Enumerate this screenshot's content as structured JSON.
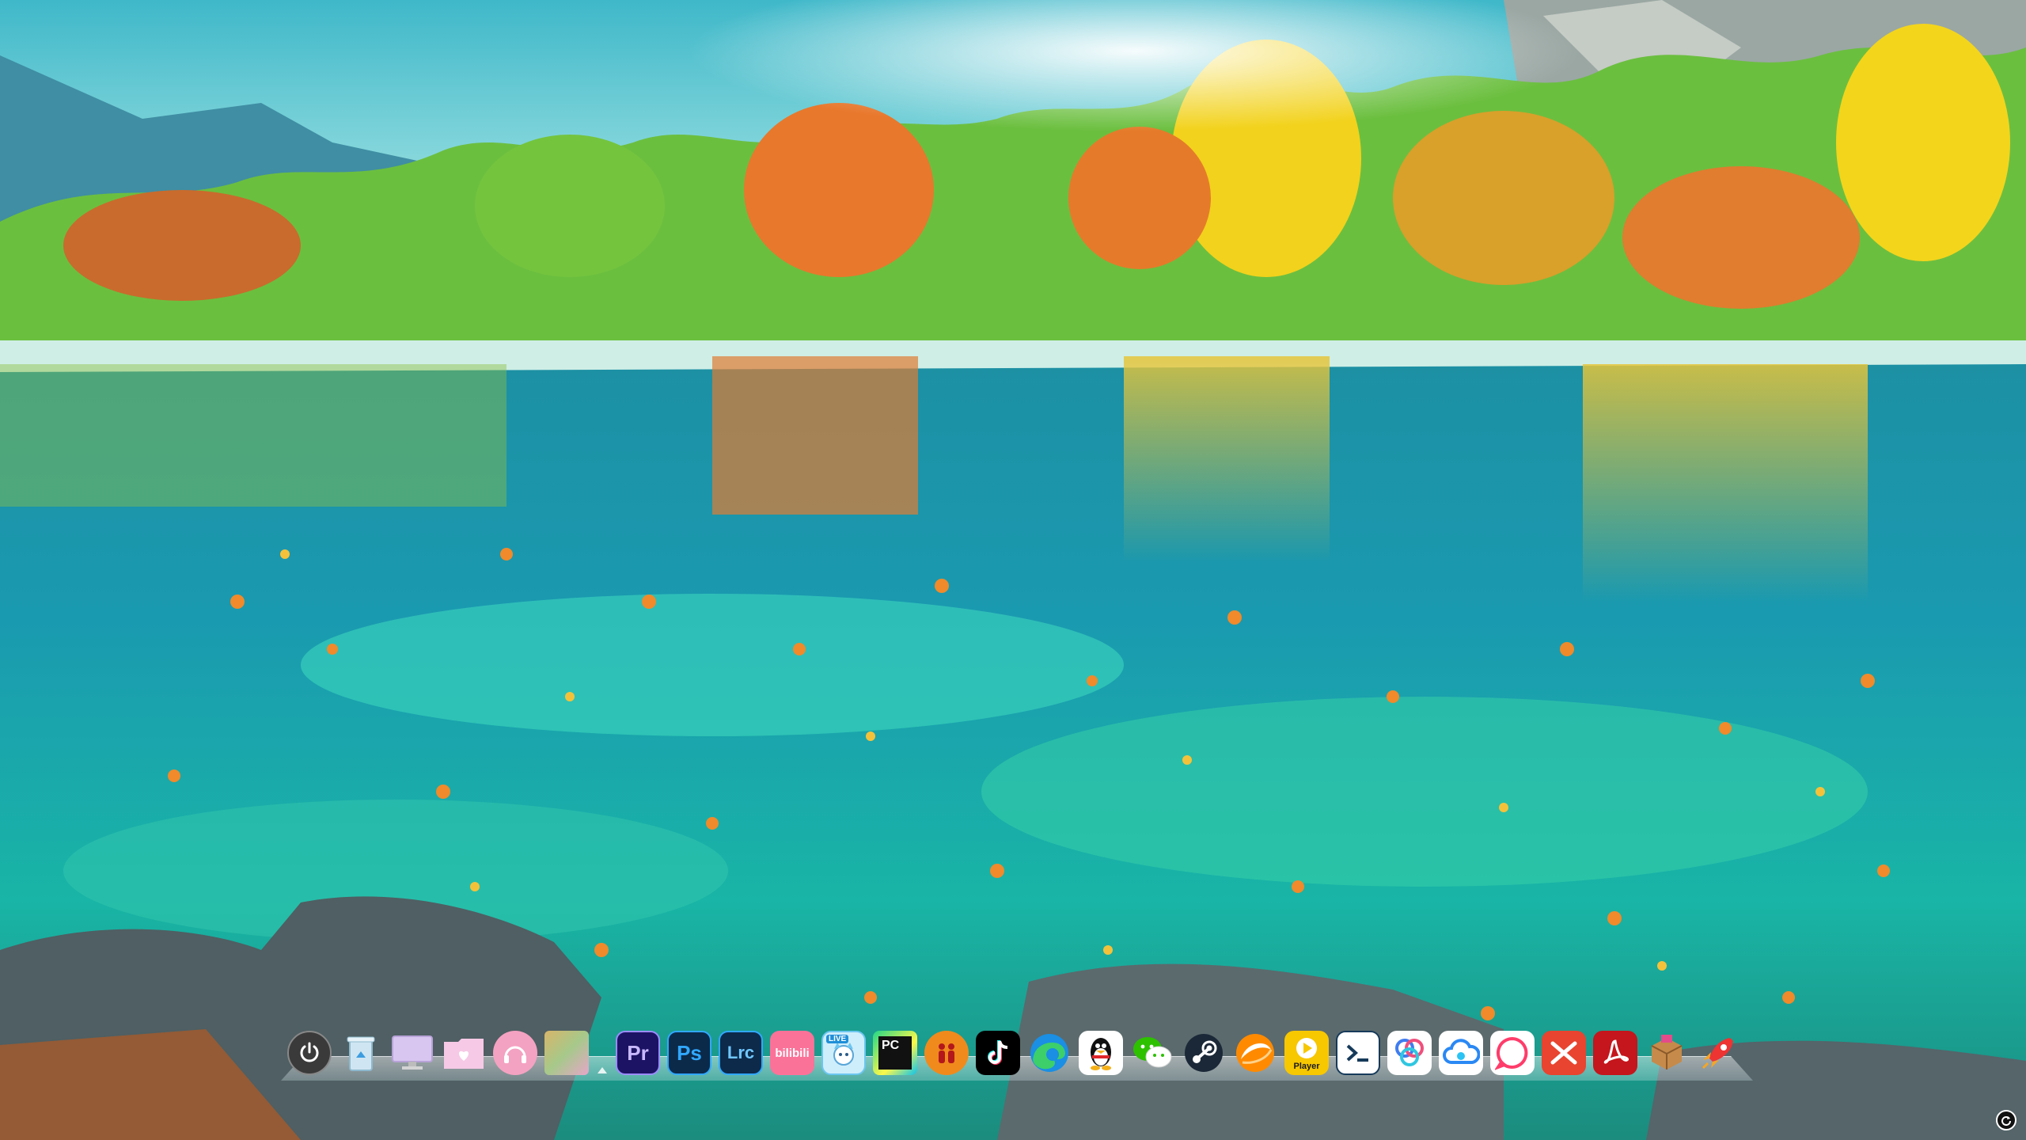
{
  "wallpaper": {
    "description_icon": "landscape-wallpaper",
    "colors": {
      "sky": "#7fd2dc",
      "water": "#19a6a8",
      "autumn": "#f0b419"
    }
  },
  "dock": {
    "items": [
      {
        "id": "power",
        "icon": "power-icon",
        "label": ""
      },
      {
        "id": "recycle-bin",
        "icon": "recycle-bin-icon",
        "label": ""
      },
      {
        "id": "this-pc",
        "icon": "monitor-icon",
        "label": ""
      },
      {
        "id": "folder",
        "icon": "folder-heart-icon",
        "label": ""
      },
      {
        "id": "music",
        "icon": "headphones-icon",
        "label": ""
      },
      {
        "id": "photos",
        "icon": "photos-icon",
        "label": ""
      },
      {
        "id": "premiere",
        "icon": "premiere-icon",
        "label": "Pr",
        "color": "#1d1364"
      },
      {
        "id": "photoshop",
        "icon": "photoshop-icon",
        "label": "Ps",
        "color": "#0b2a4a"
      },
      {
        "id": "lightroom",
        "icon": "lightroom-icon",
        "label": "Lrc",
        "color": "#0d2a4a"
      },
      {
        "id": "bilibili",
        "icon": "bilibili-icon",
        "label": "bilibili",
        "color": "#fb7299"
      },
      {
        "id": "bilibili-live",
        "icon": "bilibili-live-icon",
        "label": "LIVE",
        "color": "#6cc6f0"
      },
      {
        "id": "pycharm",
        "icon": "pycharm-icon",
        "label": "PC",
        "color": "#111111"
      },
      {
        "id": "people-app",
        "icon": "people-icon",
        "label": "",
        "color": "#f08a1c"
      },
      {
        "id": "tiktok",
        "icon": "tiktok-icon",
        "label": "",
        "color": "#000000"
      },
      {
        "id": "edge",
        "icon": "edge-icon",
        "label": ""
      },
      {
        "id": "qq",
        "icon": "qq-penguin-icon",
        "label": ""
      },
      {
        "id": "wechat",
        "icon": "wechat-icon",
        "label": ""
      },
      {
        "id": "steam",
        "icon": "steam-icon",
        "label": ""
      },
      {
        "id": "orange-app",
        "icon": "swirl-icon",
        "label": ""
      },
      {
        "id": "potplayer",
        "icon": "potplayer-icon",
        "label": "Player",
        "color": "#f7c700"
      },
      {
        "id": "terminal",
        "icon": "terminal-icon",
        "label": "",
        "color": "#163a5a"
      },
      {
        "id": "rings-app",
        "icon": "rings-icon",
        "label": ""
      },
      {
        "id": "cloud-app",
        "icon": "cloud-icon",
        "label": ""
      },
      {
        "id": "chat-app",
        "icon": "chat-bubble-icon",
        "label": ""
      },
      {
        "id": "xmind",
        "icon": "xmind-icon",
        "label": "",
        "color": "#e8442f"
      },
      {
        "id": "acrobat",
        "icon": "acrobat-icon",
        "label": "",
        "color": "#c4161c"
      },
      {
        "id": "package-app",
        "icon": "package-icon",
        "label": ""
      },
      {
        "id": "rocket-app",
        "icon": "rocket-icon",
        "label": ""
      }
    ]
  },
  "corner": {
    "icon": "refresh-icon"
  }
}
